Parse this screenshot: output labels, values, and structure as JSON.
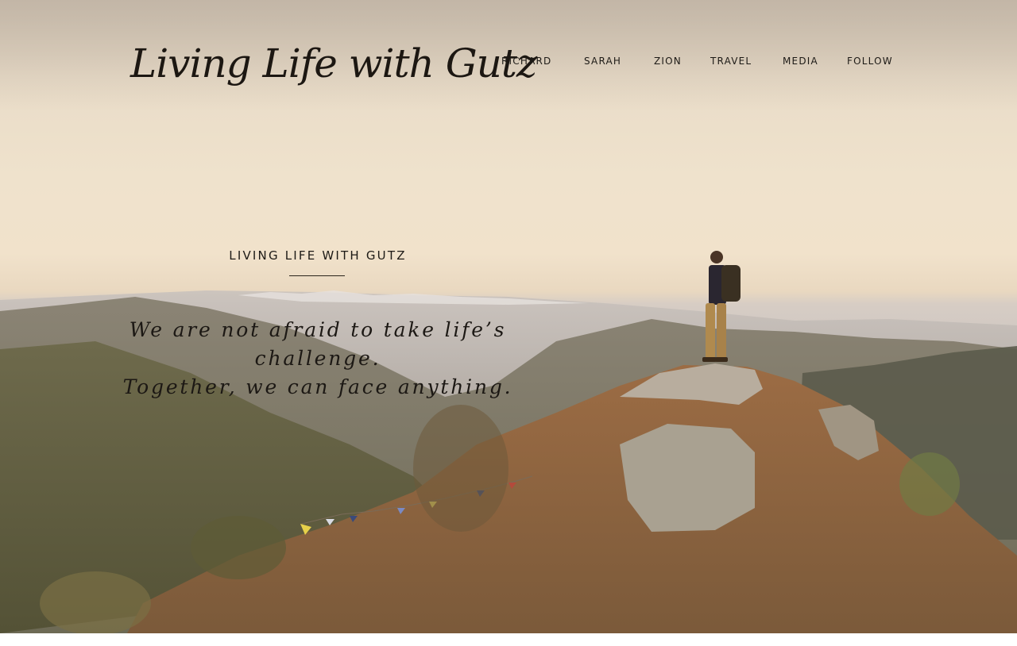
{
  "brand": {
    "logo_text": "Living Life with Gutz"
  },
  "nav": {
    "items": [
      {
        "label": "RICHARD"
      },
      {
        "label": "SARAH"
      },
      {
        "label": "ZION"
      },
      {
        "label": "TRAVEL"
      },
      {
        "label": "MEDIA"
      },
      {
        "label": "FOLLOW"
      }
    ]
  },
  "hero": {
    "kicker": "LIVING LIFE WITH GUTZ",
    "tagline_line1": "We are not afraid to take life’s challenge.",
    "tagline_line2": "Together, we can face anything."
  },
  "colors": {
    "text_dark": "#1d1a16",
    "sky_light": "#f1e2cb",
    "rock_brown": "#8a6d4a"
  }
}
